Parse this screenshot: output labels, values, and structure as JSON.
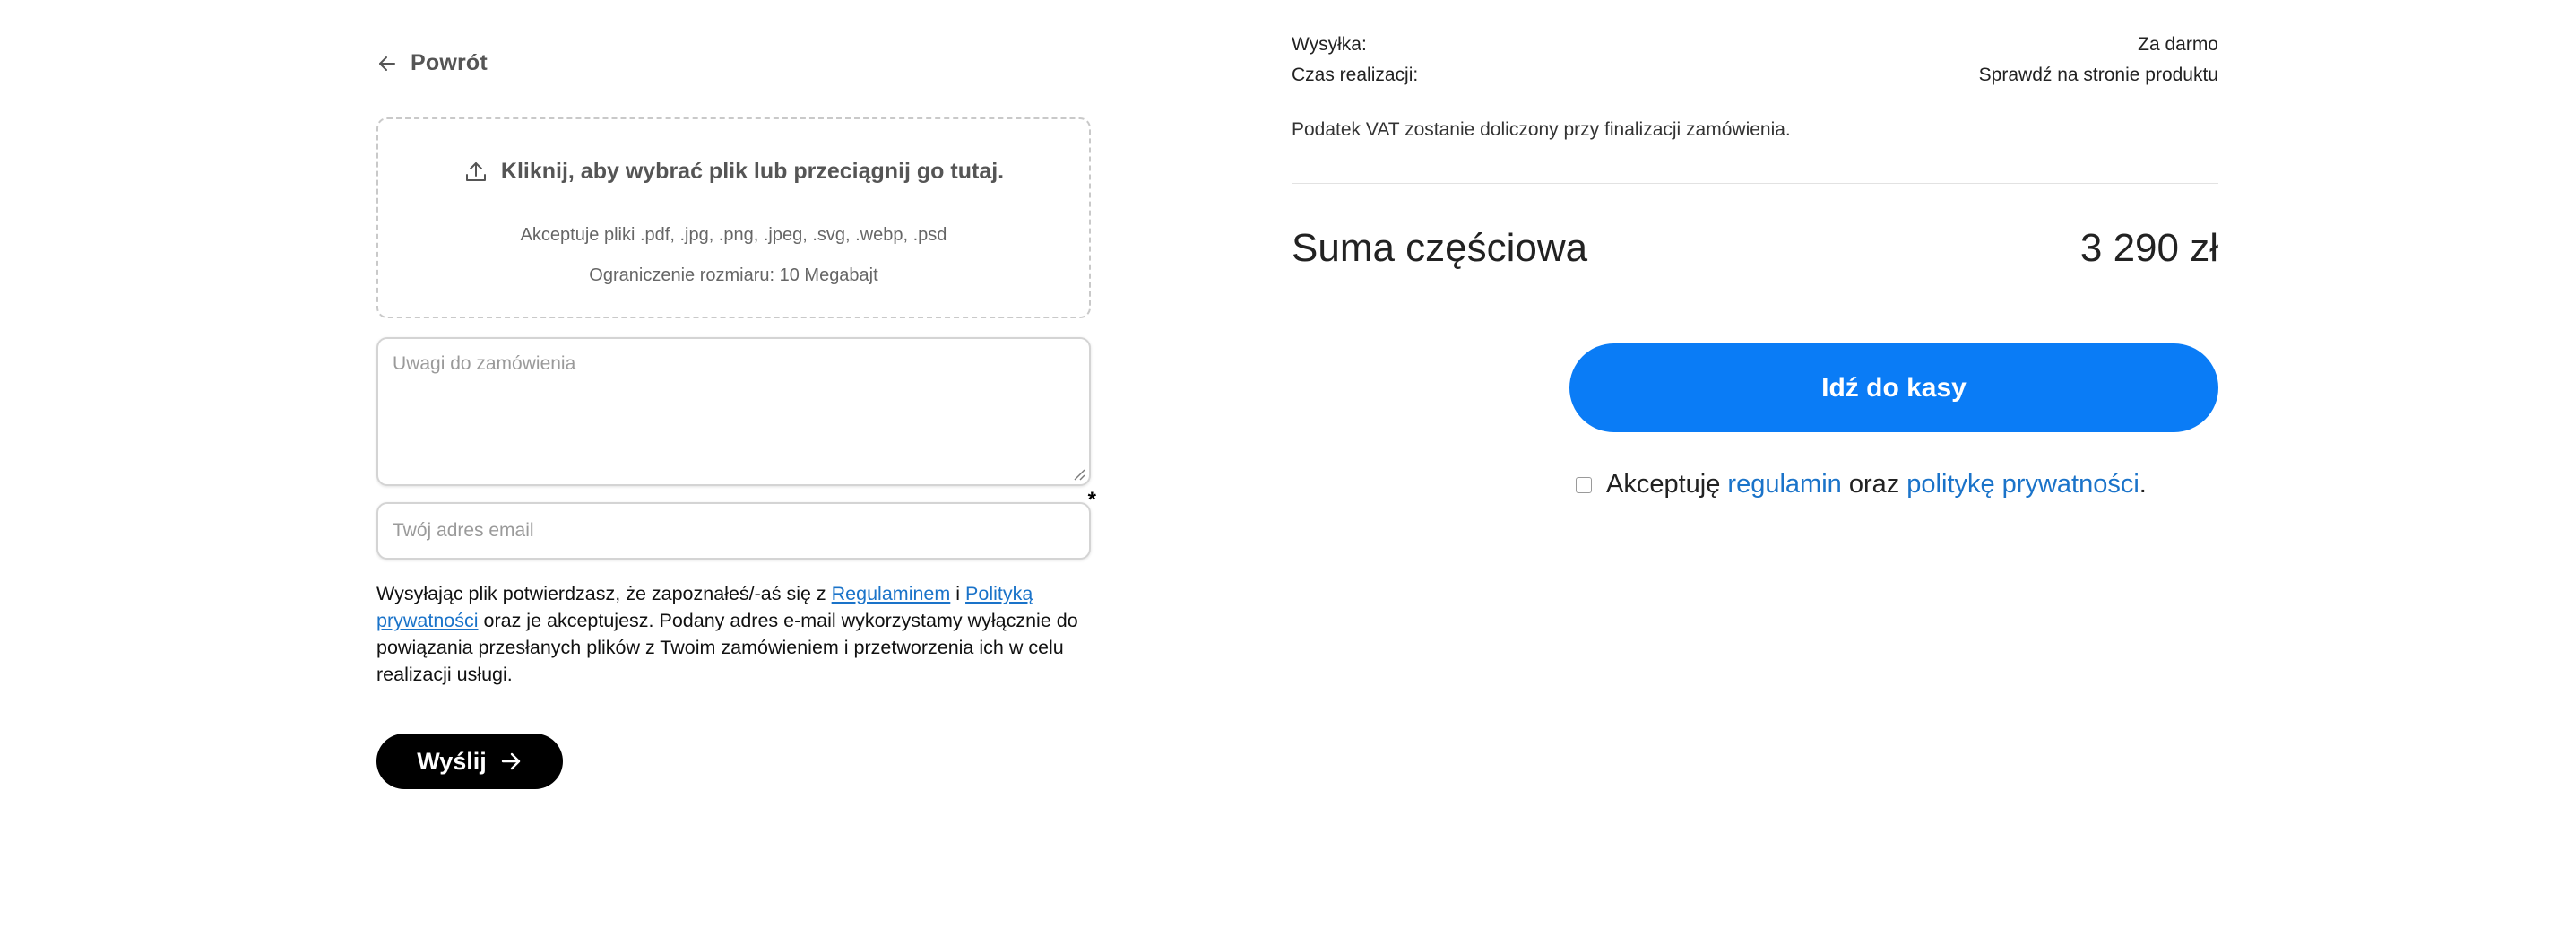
{
  "back": {
    "label": "Powrót",
    "icon": "arrow-left-icon"
  },
  "upload": {
    "headline": "Kliknij, aby wybrać plik lub przeciągnij go tutaj.",
    "icon": "upload-icon",
    "accepted_types": "Akceptuje pliki .pdf, .jpg, .png, .jpeg, .svg, .webp, .psd",
    "size_limit": "Ograniczenie rozmiaru: 10 Megabajt"
  },
  "notes": {
    "placeholder": "Uwagi do zamówienia",
    "value": ""
  },
  "email": {
    "placeholder": "Twój adres email",
    "value": "",
    "required_marker": "*"
  },
  "consent": {
    "part1": "Wysyłając plik potwierdzasz, że zapoznałeś/-aś się z ",
    "link_terms": "Regulaminem",
    "part2": " i ",
    "link_privacy": "Polityką prywatności",
    "part3": " oraz je akceptujesz. Podany adres e-mail wykorzystamy wyłącznie do powiązania przesłanych plików z Twoim zamówieniem i przetworzenia ich w celu realizacji usługi."
  },
  "send_button": {
    "label": "Wyślij",
    "icon": "arrow-right-icon"
  },
  "summary": {
    "shipping_label": "Wysyłka:",
    "shipping_value": "Za darmo",
    "fulfilment_label": "Czas realizacji:",
    "fulfilment_value": "Sprawdź na stronie produktu",
    "vat_note": "Podatek VAT zostanie doliczony przy finalizacji zamówienia.",
    "subtotal_label": "Suma częściowa",
    "subtotal_value": "3 290 zł"
  },
  "checkout": {
    "label": "Idź do kasy",
    "color": "#0a7cf6"
  },
  "terms": {
    "checked": false,
    "prefix": "Akceptuję ",
    "link_terms": "regulamin",
    "middle": " oraz ",
    "link_privacy": "politykę prywatności",
    "suffix": "."
  },
  "colors": {
    "link": "#1a73c9",
    "send_button_bg": "#000000",
    "checkout_bg": "#0a7cf6"
  }
}
